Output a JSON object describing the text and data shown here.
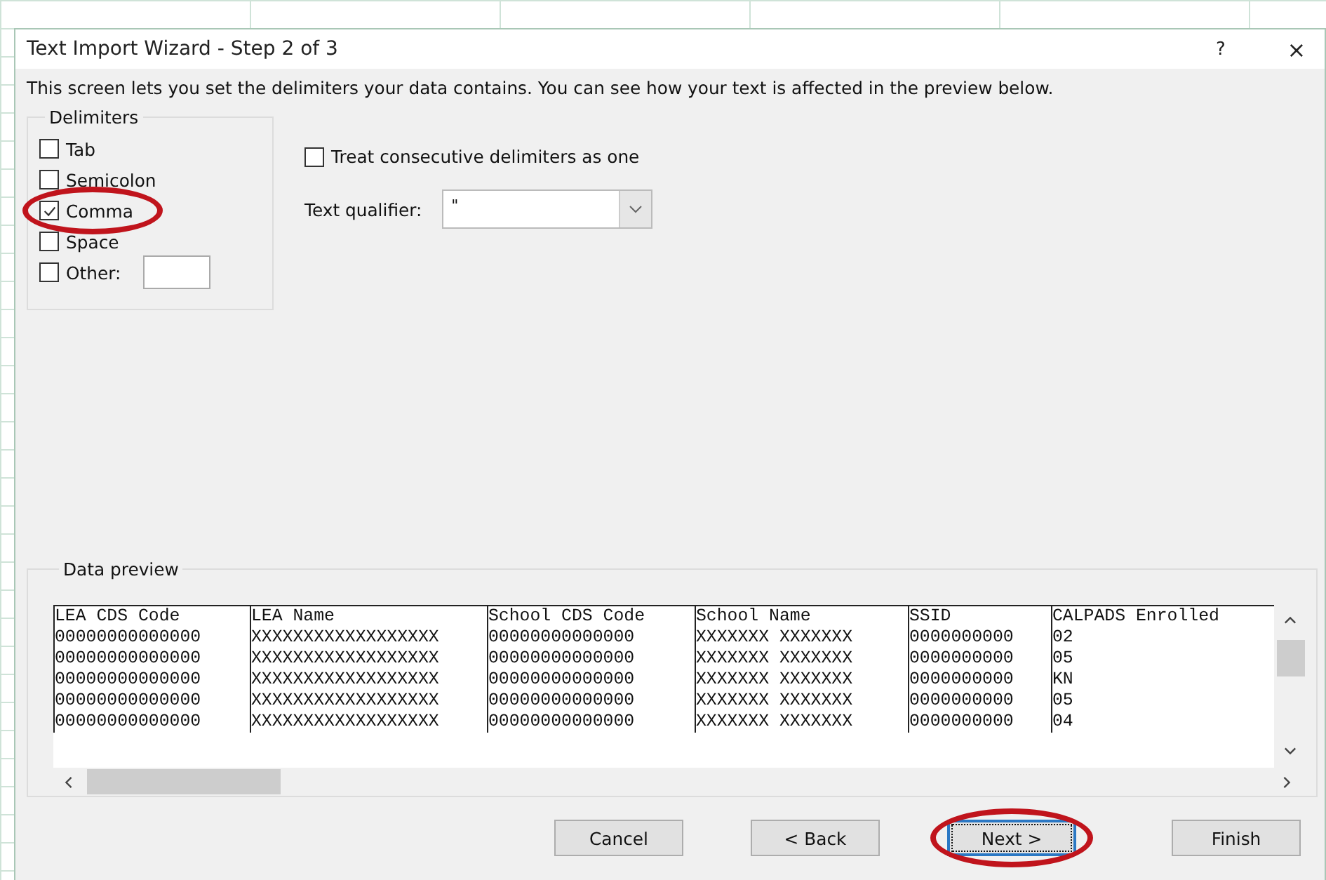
{
  "window": {
    "title": "Text Import Wizard - Step 2 of 3",
    "help": "?",
    "close": "×"
  },
  "description": "This screen lets you set the delimiters your data contains.  You can see how your text is affected in the preview below.",
  "delimiters": {
    "label": "Delimiters",
    "options": [
      {
        "label": "Tab",
        "checked": false,
        "circled": false
      },
      {
        "label": "Semicolon",
        "checked": false,
        "circled": false
      },
      {
        "label": "Comma",
        "checked": true,
        "circled": true
      },
      {
        "label": "Space",
        "checked": false,
        "circled": false
      },
      {
        "label": "Other:",
        "checked": false,
        "circled": false,
        "kind": "field"
      }
    ]
  },
  "consecutive": {
    "label": "Treat consecutive delimiters as one",
    "checked": false
  },
  "text_qualifier": {
    "label": "Text qualifier:",
    "value": "\""
  },
  "data_preview": {
    "label": "Data preview",
    "columns": [
      "LEA CDS Code",
      "LEA Name",
      "School CDS Code",
      "School Name",
      "SSID",
      "CALPADS Enrolled"
    ],
    "rows": [
      [
        "00000000000000",
        "XXXXXXXXXXXXXXXXXX",
        "00000000000000",
        "XXXXXXX XXXXXXX",
        "0000000000",
        "02"
      ],
      [
        "00000000000000",
        "XXXXXXXXXXXXXXXXXX",
        "00000000000000",
        "XXXXXXX XXXXXXX",
        "0000000000",
        "05"
      ],
      [
        "00000000000000",
        "XXXXXXXXXXXXXXXXXX",
        "00000000000000",
        "XXXXXXX XXXXXXX",
        "0000000000",
        "KN"
      ],
      [
        "00000000000000",
        "XXXXXXXXXXXXXXXXXX",
        "00000000000000",
        "XXXXXXX XXXXXXX",
        "0000000000",
        "05"
      ],
      [
        "00000000000000",
        "XXXXXXXXXXXXXXXXXX",
        "00000000000000",
        "XXXXXXX XXXXXXX",
        "0000000000",
        "04"
      ]
    ]
  },
  "buttons": [
    {
      "label": "Cancel",
      "default": false,
      "circled": false
    },
    {
      "label": "< Back",
      "default": false,
      "circled": false
    },
    {
      "label": "Next >",
      "default": true,
      "circled": true
    },
    {
      "label": "Finish",
      "default": false,
      "circled": false
    }
  ]
}
